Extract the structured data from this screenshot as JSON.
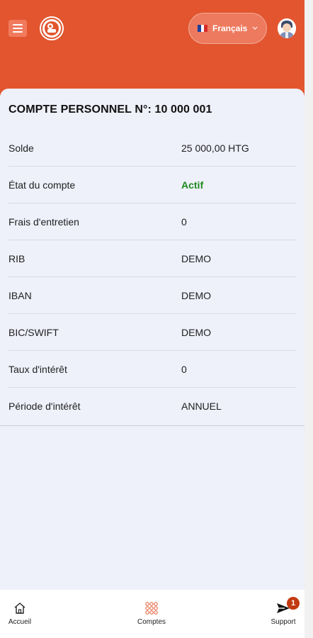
{
  "header": {
    "menu_icon": "hamburger-menu-icon",
    "logo_icon": "bank-logo-icon",
    "language": {
      "label": "Français",
      "flag": "france-flag-icon",
      "dropdown_icon": "chevron-down-icon"
    },
    "avatar_icon": "user-avatar-icon",
    "colors": {
      "primary": "#e2552e",
      "pill": "#ed7a5e"
    }
  },
  "account": {
    "title": "COMPTE PERSONNEL N°: 10 000 001",
    "rows": [
      {
        "label": "Solde",
        "value": "25 000,00 HTG"
      },
      {
        "label": "État du compte",
        "value": "Actif",
        "status_color": "#1e8a1e"
      },
      {
        "label": "Frais d'entretien",
        "value": "0"
      },
      {
        "label": "RIB",
        "value": "DEMO"
      },
      {
        "label": "IBAN",
        "value": "DEMO"
      },
      {
        "label": "BIC/SWIFT",
        "value": "DEMO"
      },
      {
        "label": "Taux d'intérêt",
        "value": "0"
      },
      {
        "label": "Période d'intérêt",
        "value": "ANNUEL"
      }
    ]
  },
  "bottom_nav": {
    "items": [
      {
        "label": "Accueil",
        "icon": "home-icon"
      },
      {
        "label": "Comptes",
        "icon": "grid-icon",
        "icon_color": "#e2552e"
      },
      {
        "label": "Support",
        "icon": "send-icon",
        "badge": "1"
      }
    ]
  }
}
